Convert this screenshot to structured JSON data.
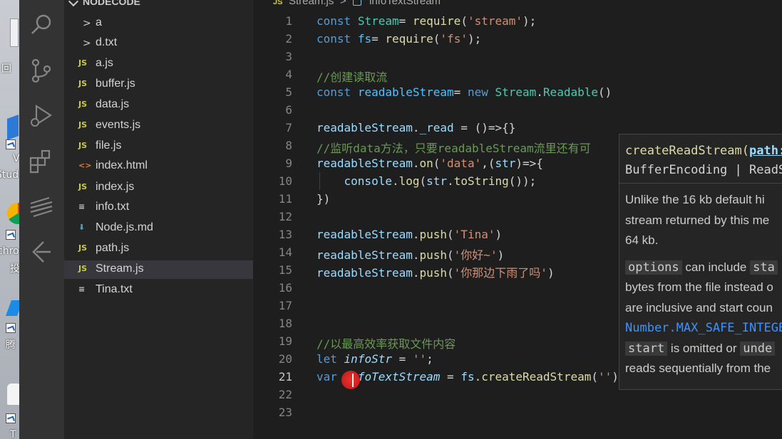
{
  "explorer": {
    "root_label": "NODECODE",
    "items": [
      {
        "label": "a",
        "type": "folder"
      },
      {
        "label": "d.txt",
        "type": "folder"
      },
      {
        "label": "a.js",
        "type": "js"
      },
      {
        "label": "buffer.js",
        "type": "js"
      },
      {
        "label": "data.js",
        "type": "js"
      },
      {
        "label": "events.js",
        "type": "js"
      },
      {
        "label": "file.js",
        "type": "js"
      },
      {
        "label": "index.html",
        "type": "html"
      },
      {
        "label": "index.js",
        "type": "js"
      },
      {
        "label": "info.txt",
        "type": "txt"
      },
      {
        "label": "Node.js.md",
        "type": "md"
      },
      {
        "label": "path.js",
        "type": "js"
      },
      {
        "label": "Stream.js",
        "type": "js",
        "active": true
      },
      {
        "label": "Tina.txt",
        "type": "txt"
      }
    ]
  },
  "breadcrumb": {
    "file_icon": "JS",
    "file": "Stream.js",
    "separator": ">",
    "symbol": "infoTextStream"
  },
  "editor": {
    "current_line": 21,
    "lines": [
      {
        "n": "1",
        "text": "const Stream= require('stream');"
      },
      {
        "n": "2",
        "text": "const fs= require('fs');"
      },
      {
        "n": "3",
        "text": ""
      },
      {
        "n": "4",
        "text": "//创建读取流"
      },
      {
        "n": "5",
        "text": "const readableStream= new Stream.Readable()"
      },
      {
        "n": "6",
        "text": ""
      },
      {
        "n": "7",
        "text": "readableStream._read = ()=>{}"
      },
      {
        "n": "8",
        "text": "//监听data方法，只要readableStream流里还有可"
      },
      {
        "n": "9",
        "text": "readableStream.on('data',(str)=>{"
      },
      {
        "n": "10",
        "text": "    console.log(str.toString());"
      },
      {
        "n": "11",
        "text": "})"
      },
      {
        "n": "12",
        "text": ""
      },
      {
        "n": "13",
        "text": "readableStream.push('Tina')"
      },
      {
        "n": "14",
        "text": "readableStream.push('你好~')"
      },
      {
        "n": "15",
        "text": "readableStream.push('你那边下雨了吗')"
      },
      {
        "n": "16",
        "text": ""
      },
      {
        "n": "17",
        "text": ""
      },
      {
        "n": "18",
        "text": ""
      },
      {
        "n": "19",
        "text": "//以最高效率获取文件内容"
      },
      {
        "n": "20",
        "text": "let infoStr = '';"
      },
      {
        "n": "21",
        "text": "var infoTextStream = fs.createReadStream('')"
      },
      {
        "n": "22",
        "text": ""
      },
      {
        "n": "23",
        "text": ""
      }
    ]
  },
  "hover": {
    "sig_fn": "createReadStream(",
    "sig_param": "path:",
    "sig_line2": "BufferEncoding | ReadS",
    "doc_line1": "Unlike the 16 kb default  hi",
    "doc_line2": "stream returned by this me",
    "doc_line3": "64 kb.",
    "doc_options_code": "options",
    "doc_options_text": " can include ",
    "doc_options_tail": "sta",
    "doc_line5": "bytes from the file instead o",
    "doc_line6": "are inclusive and start coun",
    "doc_link": "Number.MAX_SAFE_INTEGE",
    "doc_start_code": "start",
    "doc_start_text": " is omitted or ",
    "doc_start_tail": "unde",
    "doc_line9": "reads sequentially from the"
  },
  "desktop": {
    "labels": [
      "回",
      "V",
      "Stud",
      "chro",
      "投",
      "腾",
      "T"
    ]
  },
  "colors": {
    "editor_bg": "#1e1e1e",
    "sidebar_bg": "#252526",
    "activitybar_bg": "#333333",
    "keyword": "#569cd6",
    "string": "#ce9178",
    "comment": "#6a9955"
  }
}
